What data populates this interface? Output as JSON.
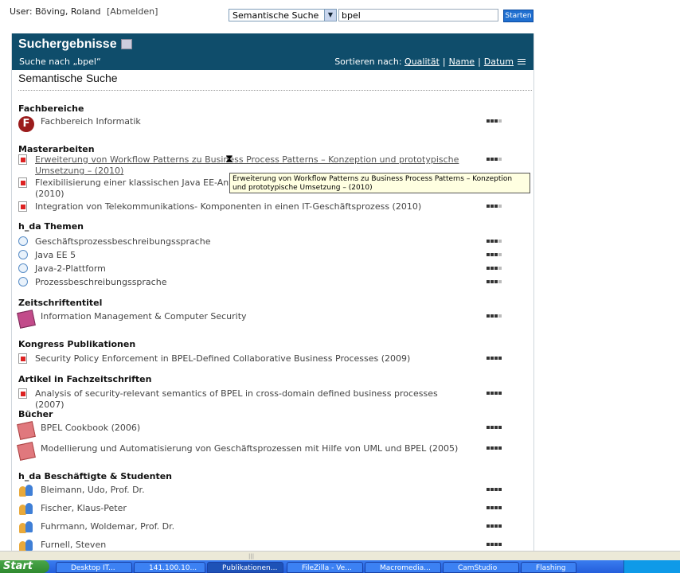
{
  "user": {
    "label": "User: Böving, Roland",
    "logout": "[Abmelden]"
  },
  "search": {
    "mode": "Semantische Suche",
    "query": "bpel",
    "submit": "Starten"
  },
  "results": {
    "title": "Suchergebnisse",
    "search_for": "Suche nach „bpel“",
    "sort_label": "Sortieren nach:",
    "sort_options": [
      "Qualität",
      "Name",
      "Datum"
    ],
    "subtitle": "Semantische Suche"
  },
  "categories": [
    {
      "name": "Fachbereiche",
      "items": [
        {
          "text": "Fachbereich Informatik",
          "icon": "faculty-icon",
          "rating": 3
        }
      ]
    },
    {
      "name": "Masterarbeiten",
      "items": [
        {
          "text": "Erweiterung von Workflow Patterns zu Business Process Patterns – Konzeption und prototypische Umsetzung – (2010)",
          "icon": "pdf-icon",
          "rating": 3
        },
        {
          "text": "Flexibilisierung einer klassischen Java EE-Anwendung",
          "text2": "(2010)",
          "icon": "pdf-icon",
          "rating": 3
        },
        {
          "text": "Integration von Telekommunikations- Komponenten in einen IT-Geschäftsprozess (2010)",
          "icon": "pdf-icon",
          "rating": 3
        }
      ]
    },
    {
      "name": "h_da Themen",
      "items": [
        {
          "text": "Geschäftsprozessbeschreibungssprache",
          "icon": "globe-icon",
          "rating": 3
        },
        {
          "text": "Java EE 5",
          "icon": "globe-icon",
          "rating": 3
        },
        {
          "text": "Java-2-Plattform",
          "icon": "globe-icon",
          "rating": 3
        },
        {
          "text": "Prozessbeschreibungssprache",
          "icon": "globe-icon",
          "rating": 3
        }
      ]
    },
    {
      "name": "Zeitschriftentitel",
      "items": [
        {
          "text": "Information Management & Computer Security",
          "icon": "journal-icon",
          "rating": 3
        }
      ]
    },
    {
      "name": "Kongress Publikationen",
      "items": [
        {
          "text": "Security Policy Enforcement in BPEL-Defined Collaborative Business Processes (2009)",
          "icon": "pdf-icon",
          "rating": 4
        }
      ]
    },
    {
      "name": "Artikel in Fachzeitschriften",
      "items": [
        {
          "text": "Analysis of security-relevant semantics of BPEL in cross-domain defined business processes (2007)",
          "icon": "pdf-icon",
          "rating": 4
        }
      ]
    },
    {
      "name": "Bücher",
      "items": [
        {
          "text": "BPEL Cookbook (2006)",
          "icon": "book-icon",
          "rating": 4
        },
        {
          "text": "Modellierung und Automatisierung von Geschäftsprozessen mit Hilfe von UML und BPEL (2005)",
          "icon": "book-icon",
          "rating": 4
        }
      ]
    },
    {
      "name": "h_da Beschäftigte & Studenten",
      "items": [
        {
          "text": "Bleimann, Udo, Prof. Dr.",
          "icon": "people-icon",
          "rating": 4
        },
        {
          "text": "Fischer, Klaus-Peter",
          "icon": "people-icon",
          "rating": 4
        },
        {
          "text": "Fuhrmann, Woldemar, Prof. Dr.",
          "icon": "people-icon",
          "rating": 4
        },
        {
          "text": "Furnell, Steven",
          "icon": "people-icon",
          "rating": 4
        }
      ]
    }
  ],
  "tooltip": "Erweiterung von Workflow Patterns zu Business Process Patterns – Konzeption und prototypische Umsetzung – (2010)",
  "taskbar": {
    "start": "Start",
    "tasks": [
      "Desktop IT...",
      "141.100.10...",
      "Publikationen...",
      "FileZilla - Ve...",
      "Macromedia...",
      "CamStudio",
      "Flashing"
    ]
  }
}
